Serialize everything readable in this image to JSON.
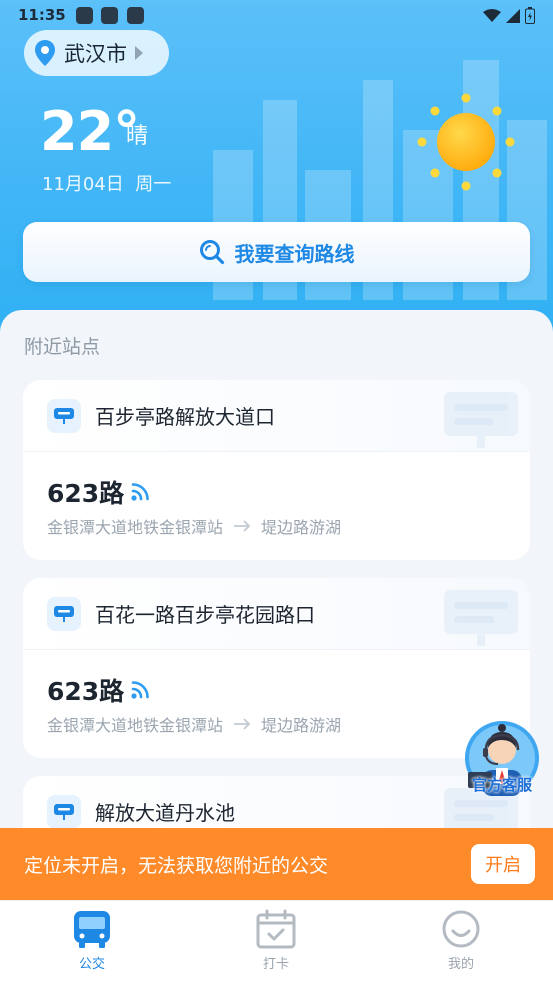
{
  "status_bar": {
    "time": "11:35"
  },
  "location": {
    "city": "武汉市"
  },
  "weather": {
    "temperature": "22°",
    "condition": "晴",
    "date": "11月04日",
    "weekday": "周一"
  },
  "route_search": {
    "label": "我要查询路线"
  },
  "nearby": {
    "title": "附近站点",
    "stops": [
      {
        "name": "百步亭路解放大道口",
        "route": "623路",
        "from": "金银潭大道地铁金银潭站",
        "to": "堤边路游湖"
      },
      {
        "name": "百花一路百步亭花园路口",
        "route": "623路",
        "from": "金银潭大道地铁金银潭站",
        "to": "堤边路游湖"
      },
      {
        "name": "解放大道丹水池"
      }
    ]
  },
  "customer_service": {
    "label": "官方客服"
  },
  "location_banner": {
    "message": "定位未开启，无法获取您附近的公交",
    "button": "开启"
  },
  "tabbar": {
    "items": [
      {
        "label": "公交",
        "active": true
      },
      {
        "label": "打卡"
      },
      {
        "label": "我的"
      }
    ]
  },
  "colors": {
    "primary": "#1e88e5",
    "banner": "#ff8a2a",
    "hero": "#41b6f6"
  }
}
